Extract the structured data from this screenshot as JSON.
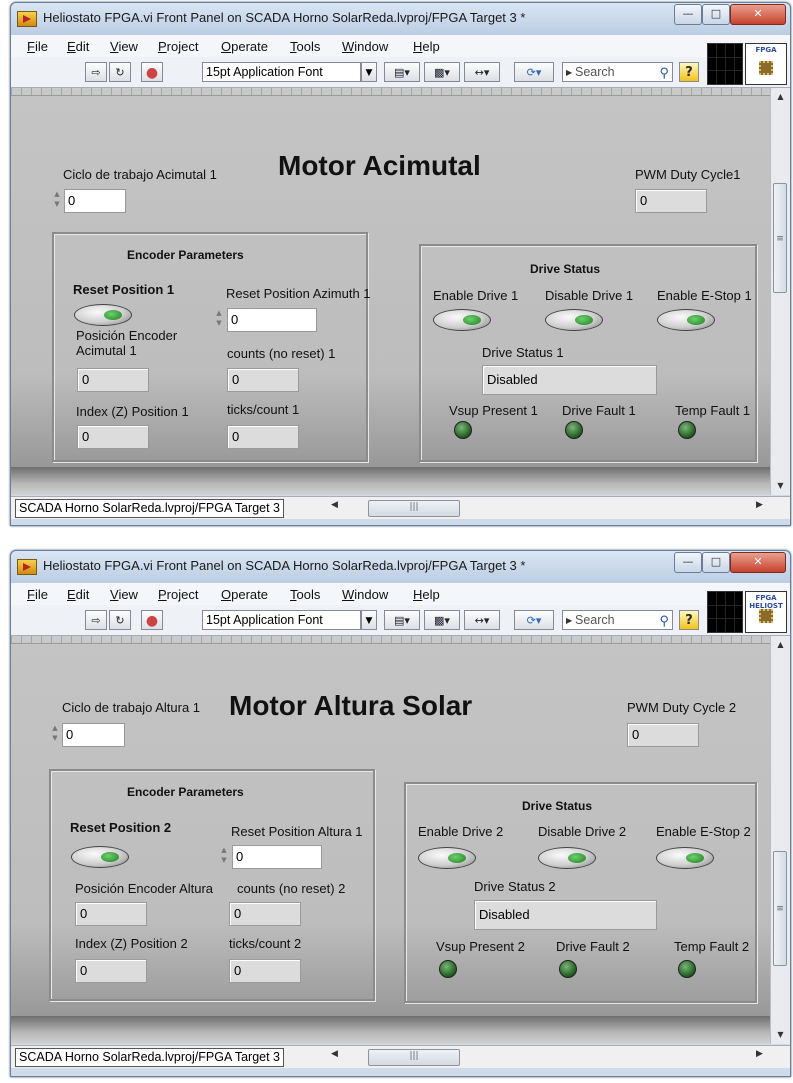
{
  "windows": [
    {
      "title": "Heliostato FPGA.vi Front Panel on SCADA Horno SolarReda.lvproj/FPGA Target 3 *",
      "menu": [
        "File",
        "Edit",
        "View",
        "Project",
        "Operate",
        "Tools",
        "Window",
        "Help"
      ],
      "toolbar": {
        "font": "15pt Application Font",
        "search_placeholder": "Search"
      },
      "vi_icon_text": "FPGA",
      "panel": {
        "heading": "Motor Acimutal",
        "duty_label": "Ciclo de trabajo Acimutal 1",
        "duty_value": "0",
        "pwm_label": "PWM Duty Cycle1",
        "pwm_value": "0",
        "encoder": {
          "title": "Encoder Parameters",
          "reset_label": "Reset Position 1",
          "reset_pos_label": "Reset Position Azimuth 1",
          "reset_pos_value": "0",
          "pos_label": "Posición Encoder Acimutal 1",
          "pos_value": "0",
          "counts_label": "counts (no reset) 1",
          "counts_value": "0",
          "index_label": "Index (Z) Position 1",
          "index_value": "0",
          "ticks_label": "ticks/count 1",
          "ticks_value": "0"
        },
        "drive": {
          "title": "Drive Status",
          "enable_label": "Enable Drive 1",
          "disable_label": "Disable Drive 1",
          "estop_label": "Enable E-Stop 1",
          "status_label": "Drive Status 1",
          "status_value": "Disabled",
          "vsup_label": "Vsup Present 1",
          "fault_label": "Drive Fault 1",
          "temp_label": "Temp Fault 1"
        }
      },
      "path": "SCADA Horno SolarReda.lvproj/FPGA Target 3"
    },
    {
      "title": "Heliostato FPGA.vi Front Panel on SCADA Horno SolarReda.lvproj/FPGA Target 3 *",
      "menu": [
        "File",
        "Edit",
        "View",
        "Project",
        "Operate",
        "Tools",
        "Window",
        "Help"
      ],
      "toolbar": {
        "font": "15pt Application Font",
        "search_placeholder": "Search"
      },
      "vi_icon_text": "FPGA HELIOST",
      "panel": {
        "heading": "Motor Altura Solar",
        "duty_label": "Ciclo de trabajo Altura 1",
        "duty_value": "0",
        "pwm_label": "PWM Duty Cycle 2",
        "pwm_value": "0",
        "encoder": {
          "title": "Encoder Parameters",
          "reset_label": "Reset Position 2",
          "reset_pos_label": "Reset Position Altura 1",
          "reset_pos_value": "0",
          "pos_label": "Posición Encoder Altura",
          "pos_value": "0",
          "counts_label": "counts (no reset) 2",
          "counts_value": "0",
          "index_label": "Index (Z) Position 2",
          "index_value": "0",
          "ticks_label": "ticks/count 2",
          "ticks_value": "0"
        },
        "drive": {
          "title": "Drive Status",
          "enable_label": "Enable Drive 2",
          "disable_label": "Disable Drive 2",
          "estop_label": "Enable E-Stop 2",
          "status_label": "Drive Status 2",
          "status_value": "Disabled",
          "vsup_label": "Vsup Present 2",
          "fault_label": "Drive Fault 2",
          "temp_label": "Temp Fault 2"
        }
      },
      "path": "SCADA Horno SolarReda.lvproj/FPGA Target 3"
    }
  ]
}
